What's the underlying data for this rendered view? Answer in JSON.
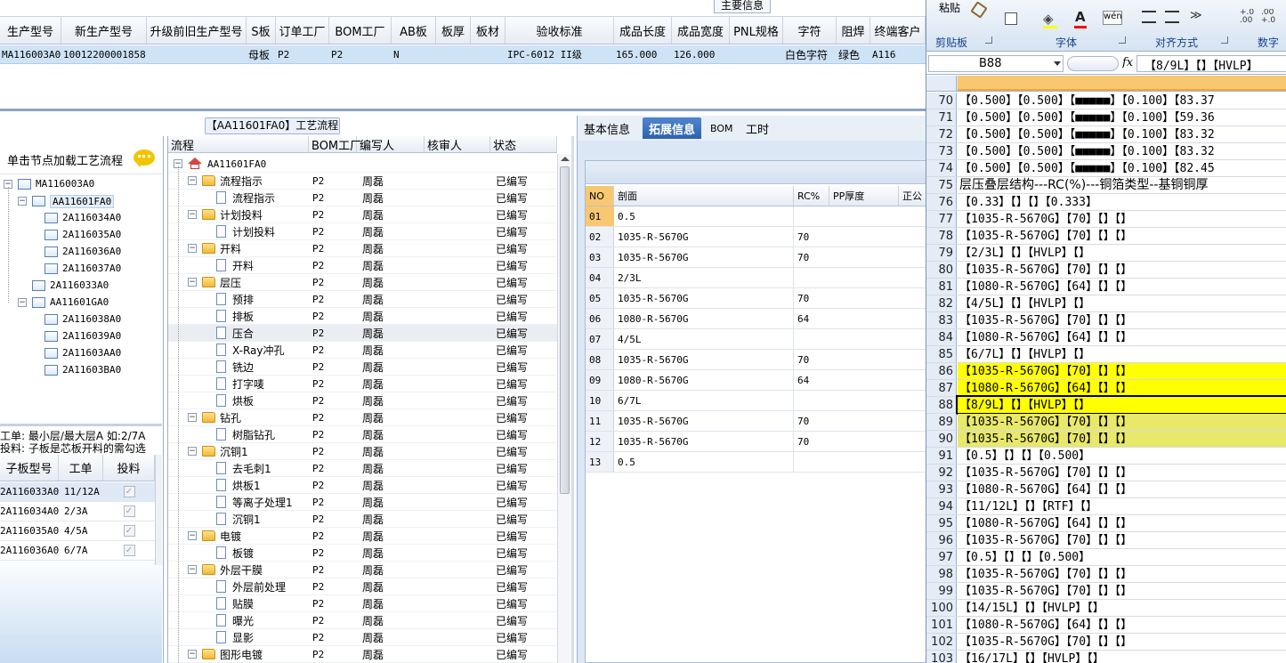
{
  "summary_tab": "主要信息",
  "top_grid": {
    "columns": [
      "生产型号",
      "新生产型号",
      "升级前旧生产型号",
      "S板",
      "订单工厂",
      "BOM工厂",
      "AB板",
      "板厚",
      "板材",
      "验收标准",
      "成品长度",
      "成品宽度",
      "PNL规格",
      "字符",
      "阻焊",
      "终端客户"
    ],
    "row": [
      "MA116003A0",
      "10012200001858",
      "",
      "母板",
      "P2",
      "P2",
      "N",
      "",
      "",
      "IPC-6012 II级",
      "165.000",
      "126.000",
      "",
      "白色字符",
      "绿色",
      "A116"
    ]
  },
  "process_panel_title": "【AA11601FA0】工艺流程",
  "left_tree": {
    "hint": "单击节点加载工艺流程",
    "nodes": [
      {
        "label": "MA116003A0",
        "level": 0,
        "selected": false
      },
      {
        "label": "AA11601FA0",
        "level": 1,
        "selected": true
      },
      {
        "label": "2A116034A0",
        "level": 2,
        "selected": false
      },
      {
        "label": "2A116035A0",
        "level": 2,
        "selected": false
      },
      {
        "label": "2A116036A0",
        "level": 2,
        "selected": false
      },
      {
        "label": "2A116037A0",
        "level": 2,
        "selected": false
      },
      {
        "label": "2A116033A0",
        "level": 1,
        "selected": false
      },
      {
        "label": "AA11601GA0",
        "level": 1,
        "selected": false
      },
      {
        "label": "2A116038A0",
        "level": 2,
        "selected": false
      },
      {
        "label": "2A116039A0",
        "level": 2,
        "selected": false
      },
      {
        "label": "2A11603AA0",
        "level": 2,
        "selected": false
      },
      {
        "label": "2A11603BA0",
        "level": 2,
        "selected": false
      }
    ],
    "note_line1": "工单: 最小层/最大层A 如:2/7A",
    "note_line2": "投料: 子板是芯板开料的需勾选"
  },
  "sub_grid": {
    "columns": [
      "子板型号",
      "工单",
      "投料"
    ],
    "rows": [
      {
        "model": "2A116033A0",
        "order": "11/12A",
        "feed": "✓"
      },
      {
        "model": "2A116034A0",
        "order": "2/3A",
        "feed": "✓"
      },
      {
        "model": "2A116035A0",
        "order": "4/5A",
        "feed": "✓"
      },
      {
        "model": "2A116036A0",
        "order": "6/7A",
        "feed": "✓"
      }
    ]
  },
  "flow_grid": {
    "columns": [
      "流程",
      "BOM工厂",
      "编写人",
      "核审人",
      "状态"
    ],
    "rows": [
      {
        "name": "AA11601FA0",
        "level": 0,
        "kind": "root",
        "bom": "",
        "author": "",
        "reviewer": "",
        "status": ""
      },
      {
        "name": "流程指示",
        "level": 1,
        "kind": "folder",
        "bom": "P2",
        "author": "周磊",
        "reviewer": "",
        "status": "已编写"
      },
      {
        "name": "流程指示",
        "level": 2,
        "kind": "doc",
        "bom": "P2",
        "author": "周磊",
        "reviewer": "",
        "status": "已编写"
      },
      {
        "name": "计划投料",
        "level": 1,
        "kind": "folder",
        "bom": "P2",
        "author": "周磊",
        "reviewer": "",
        "status": "已编写"
      },
      {
        "name": "计划投料",
        "level": 2,
        "kind": "doc",
        "bom": "P2",
        "author": "周磊",
        "reviewer": "",
        "status": "已编写"
      },
      {
        "name": "开料",
        "level": 1,
        "kind": "folder",
        "bom": "P2",
        "author": "周磊",
        "reviewer": "",
        "status": "已编写"
      },
      {
        "name": "开料",
        "level": 2,
        "kind": "doc",
        "bom": "P2",
        "author": "周磊",
        "reviewer": "",
        "status": "已编写"
      },
      {
        "name": "层压",
        "level": 1,
        "kind": "folder",
        "bom": "P2",
        "author": "周磊",
        "reviewer": "",
        "status": "已编写"
      },
      {
        "name": "预排",
        "level": 2,
        "kind": "doc",
        "bom": "P2",
        "author": "周磊",
        "reviewer": "",
        "status": "已编写"
      },
      {
        "name": "排板",
        "level": 2,
        "kind": "doc",
        "bom": "P2",
        "author": "周磊",
        "reviewer": "",
        "status": "已编写"
      },
      {
        "name": "压合",
        "level": 2,
        "kind": "doc",
        "bom": "P2",
        "author": "周磊",
        "reviewer": "",
        "status": "已编写",
        "selected": true
      },
      {
        "name": "X-Ray冲孔",
        "level": 2,
        "kind": "doc",
        "bom": "P2",
        "author": "周磊",
        "reviewer": "",
        "status": "已编写"
      },
      {
        "name": "铣边",
        "level": 2,
        "kind": "doc",
        "bom": "P2",
        "author": "周磊",
        "reviewer": "",
        "status": "已编写"
      },
      {
        "name": "打字唛",
        "level": 2,
        "kind": "doc",
        "bom": "P2",
        "author": "周磊",
        "reviewer": "",
        "status": "已编写"
      },
      {
        "name": "烘板",
        "level": 2,
        "kind": "doc",
        "bom": "P2",
        "author": "周磊",
        "reviewer": "",
        "status": "已编写"
      },
      {
        "name": "钻孔",
        "level": 1,
        "kind": "folder",
        "bom": "P2",
        "author": "周磊",
        "reviewer": "",
        "status": "已编写"
      },
      {
        "name": "树脂钻孔",
        "level": 2,
        "kind": "doc",
        "bom": "P2",
        "author": "周磊",
        "reviewer": "",
        "status": "已编写"
      },
      {
        "name": "沉铜1",
        "level": 1,
        "kind": "folder",
        "bom": "P2",
        "author": "周磊",
        "reviewer": "",
        "status": "已编写"
      },
      {
        "name": "去毛刺1",
        "level": 2,
        "kind": "doc",
        "bom": "P2",
        "author": "周磊",
        "reviewer": "",
        "status": "已编写"
      },
      {
        "name": "烘板1",
        "level": 2,
        "kind": "doc",
        "bom": "P2",
        "author": "周磊",
        "reviewer": "",
        "status": "已编写"
      },
      {
        "name": "等离子处理1",
        "level": 2,
        "kind": "doc",
        "bom": "P2",
        "author": "周磊",
        "reviewer": "",
        "status": "已编写"
      },
      {
        "name": "沉铜1",
        "level": 2,
        "kind": "doc",
        "bom": "P2",
        "author": "周磊",
        "reviewer": "",
        "status": "已编写"
      },
      {
        "name": "电镀",
        "level": 1,
        "kind": "folder",
        "bom": "P2",
        "author": "周磊",
        "reviewer": "",
        "status": "已编写"
      },
      {
        "name": "板镀",
        "level": 2,
        "kind": "doc",
        "bom": "P2",
        "author": "周磊",
        "reviewer": "",
        "status": "已编写"
      },
      {
        "name": "外层干膜",
        "level": 1,
        "kind": "folder",
        "bom": "P2",
        "author": "周磊",
        "reviewer": "",
        "status": "已编写"
      },
      {
        "name": "外层前处理",
        "level": 2,
        "kind": "doc",
        "bom": "P2",
        "author": "周磊",
        "reviewer": "",
        "status": "已编写"
      },
      {
        "name": "贴膜",
        "level": 2,
        "kind": "doc",
        "bom": "P2",
        "author": "周磊",
        "reviewer": "",
        "status": "已编写"
      },
      {
        "name": "曝光",
        "level": 2,
        "kind": "doc",
        "bom": "P2",
        "author": "周磊",
        "reviewer": "",
        "status": "已编写"
      },
      {
        "name": "显影",
        "level": 2,
        "kind": "doc",
        "bom": "P2",
        "author": "周磊",
        "reviewer": "",
        "status": "已编写"
      },
      {
        "name": "图形电镀",
        "level": 1,
        "kind": "folder",
        "bom": "P2",
        "author": "周磊",
        "reviewer": "",
        "status": "已编写"
      }
    ]
  },
  "detail_tabs": [
    {
      "label": "基本信息",
      "active": false
    },
    {
      "label": "拓展信息",
      "active": true
    },
    {
      "label": "BOM",
      "active": false
    },
    {
      "label": "工时",
      "active": false
    }
  ],
  "section_grid": {
    "columns": [
      "NO",
      "剖面",
      "RC%",
      "PP厚度",
      "正公"
    ],
    "rows": [
      {
        "no": "01",
        "section": "0.5",
        "rc": "",
        "pp": ""
      },
      {
        "no": "02",
        "section": "1035-R-5670G",
        "rc": "70",
        "pp": ""
      },
      {
        "no": "03",
        "section": "1035-R-5670G",
        "rc": "70",
        "pp": ""
      },
      {
        "no": "04",
        "section": "2/3L",
        "rc": "",
        "pp": ""
      },
      {
        "no": "05",
        "section": "1035-R-5670G",
        "rc": "70",
        "pp": ""
      },
      {
        "no": "06",
        "section": "1080-R-5670G",
        "rc": "64",
        "pp": ""
      },
      {
        "no": "07",
        "section": "4/5L",
        "rc": "",
        "pp": ""
      },
      {
        "no": "08",
        "section": "1035-R-5670G",
        "rc": "70",
        "pp": ""
      },
      {
        "no": "09",
        "section": "1080-R-5670G",
        "rc": "64",
        "pp": ""
      },
      {
        "no": "10",
        "section": "6/7L",
        "rc": "",
        "pp": ""
      },
      {
        "no": "11",
        "section": "1035-R-5670G",
        "rc": "70",
        "pp": ""
      },
      {
        "no": "12",
        "section": "1035-R-5670G",
        "rc": "70",
        "pp": ""
      },
      {
        "no": "13",
        "section": "0.5",
        "rc": "",
        "pp": ""
      }
    ]
  },
  "excel": {
    "ribbon_groups": [
      "剪贴板",
      "字体",
      "对齐方式",
      "数字"
    ],
    "paste_label": "粘贴",
    "name_box": "B88",
    "fx_label": "fx",
    "formula": "【8/9L】【】【HVLP】",
    "colors": {
      "yellow": "#ffff00",
      "selected_yellow": "#e8e86a",
      "header_blue": "#dbe5f1"
    },
    "rows": [
      {
        "num": "70",
        "text": "【0.500】【0.500】【■■■■■】【0.100】【83.37",
        "hl": ""
      },
      {
        "num": "71",
        "text": "【0.500】【0.500】【■■■■■】【0.100】【59.36",
        "hl": ""
      },
      {
        "num": "72",
        "text": "【0.500】【0.500】【■■■■■】【0.100】【83.32",
        "hl": ""
      },
      {
        "num": "73",
        "text": "【0.500】【0.500】【■■■■■】【0.100】【83.32",
        "hl": ""
      },
      {
        "num": "74",
        "text": "【0.500】【0.500】【■■■■■】【0.100】【82.45",
        "hl": ""
      },
      {
        "num": "75",
        "text": "层压叠层结构---RC(%)---铜箔类型--基铜铜厚",
        "hl": ""
      },
      {
        "num": "76",
        "text": "【0.33】【】【】【0.333】",
        "hl": ""
      },
      {
        "num": "77",
        "text": "【1035-R-5670G】【70】【】【】",
        "hl": ""
      },
      {
        "num": "78",
        "text": "【1035-R-5670G】【70】【】【】",
        "hl": ""
      },
      {
        "num": "79",
        "text": "【2/3L】【】【HVLP】【】",
        "hl": ""
      },
      {
        "num": "80",
        "text": "【1035-R-5670G】【70】【】【】",
        "hl": ""
      },
      {
        "num": "81",
        "text": "【1080-R-5670G】【64】【】【】",
        "hl": ""
      },
      {
        "num": "82",
        "text": "【4/5L】【】【HVLP】【】",
        "hl": ""
      },
      {
        "num": "83",
        "text": "【1035-R-5670G】【70】【】【】",
        "hl": ""
      },
      {
        "num": "84",
        "text": "【1080-R-5670G】【64】【】【】",
        "hl": ""
      },
      {
        "num": "85",
        "text": "【6/7L】【】【HVLP】【】",
        "hl": ""
      },
      {
        "num": "86",
        "text": "【1035-R-5670G】【70】【】【】",
        "hl": "y"
      },
      {
        "num": "87",
        "text": "【1080-R-5670G】【64】【】【】",
        "hl": "y"
      },
      {
        "num": "88",
        "text": "【8/9L】【】【HVLP】【】",
        "hl": "y"
      },
      {
        "num": "89",
        "text": "【1035-R-5670G】【70】【】【】",
        "hl": "s"
      },
      {
        "num": "90",
        "text": "【1035-R-5670G】【70】【】【】",
        "hl": "s"
      },
      {
        "num": "91",
        "text": "【0.5】【】【】【0.500】",
        "hl": ""
      },
      {
        "num": "92",
        "text": "【1035-R-5670G】【70】【】【】",
        "hl": ""
      },
      {
        "num": "93",
        "text": "【1080-R-5670G】【64】【】【】",
        "hl": ""
      },
      {
        "num": "94",
        "text": "【11/12L】【】【RTF】【】",
        "hl": ""
      },
      {
        "num": "95",
        "text": "【1080-R-5670G】【64】【】【】",
        "hl": ""
      },
      {
        "num": "96",
        "text": "【1035-R-5670G】【70】【】【】",
        "hl": ""
      },
      {
        "num": "97",
        "text": "【0.5】【】【】【0.500】",
        "hl": ""
      },
      {
        "num": "98",
        "text": "【1035-R-5670G】【70】【】【】",
        "hl": ""
      },
      {
        "num": "99",
        "text": "【1035-R-5670G】【70】【】【】",
        "hl": ""
      },
      {
        "num": "100",
        "text": "【14/15L】【】【HVLP】【】",
        "hl": ""
      },
      {
        "num": "101",
        "text": "【1080-R-5670G】【64】【】【】",
        "hl": ""
      },
      {
        "num": "102",
        "text": "【1035-R-5670G】【70】【】【】",
        "hl": ""
      },
      {
        "num": "103",
        "text": "【16/17L】【】【HVLP】【】",
        "hl": ""
      }
    ]
  }
}
